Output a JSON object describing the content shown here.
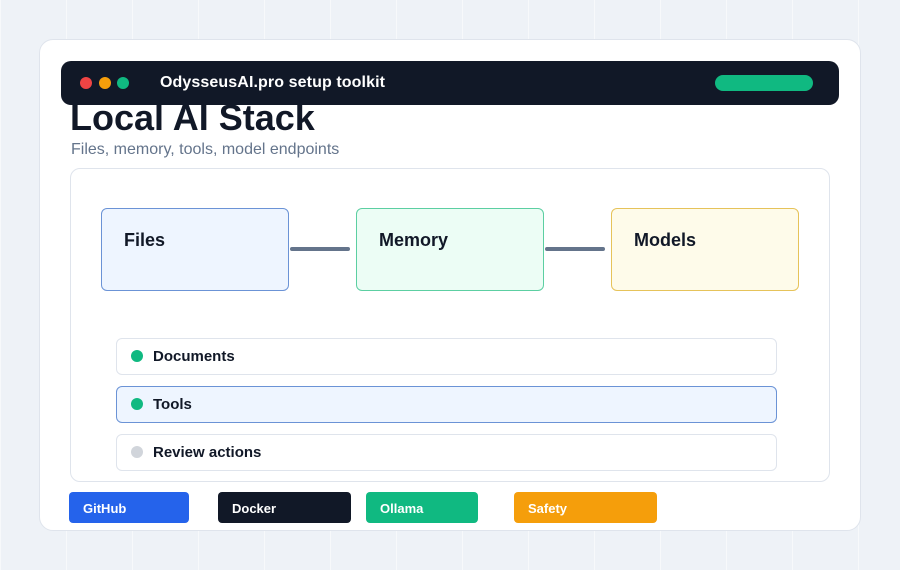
{
  "window": {
    "title": "OdysseusAI.pro setup toolkit",
    "controls": [
      "close-dot",
      "minimize-dot",
      "maximize-dot"
    ]
  },
  "header": {
    "title": "Local AI Stack",
    "subtitle": "Files, memory, tools, model endpoints"
  },
  "diagram": {
    "nodes": [
      {
        "label": "Files"
      },
      {
        "label": "Memory"
      },
      {
        "label": "Models"
      }
    ],
    "edges": [
      {
        "from": "Files",
        "to": "Memory"
      },
      {
        "from": "Memory",
        "to": "Models"
      }
    ]
  },
  "checklist": {
    "items": [
      {
        "label": "Documents",
        "status": "done",
        "status_color": "#10b981"
      },
      {
        "label": "Tools",
        "status": "done",
        "status_color": "#10b981",
        "selected": true
      },
      {
        "label": "Review actions",
        "status": "pending",
        "status_color": "#d1d5db"
      }
    ]
  },
  "badges": [
    {
      "label": "GitHub",
      "color": "#2563eb"
    },
    {
      "label": "Docker",
      "color": "#111827"
    },
    {
      "label": "Ollama",
      "color": "#10b981"
    },
    {
      "label": "Safety",
      "color": "#f59e0b"
    }
  ],
  "colors": {
    "accent_green": "#10b981",
    "titlebar": "#111827",
    "text_primary": "#111827",
    "text_muted": "#64748b"
  }
}
